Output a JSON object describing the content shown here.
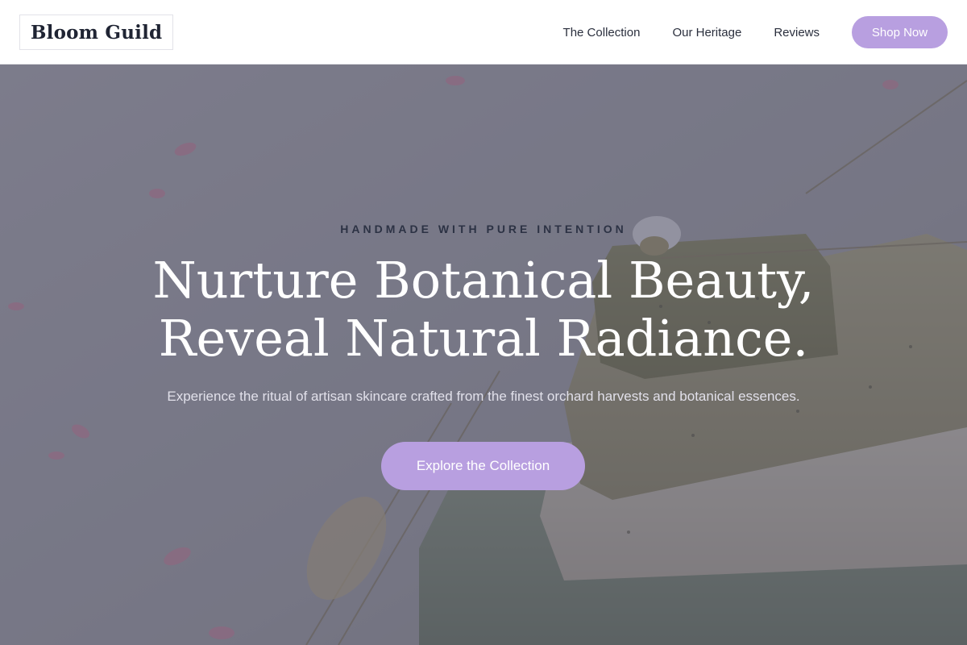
{
  "header": {
    "logo": "Bloom Guild",
    "nav": [
      {
        "label": "The Collection"
      },
      {
        "label": "Our Heritage"
      },
      {
        "label": "Reviews"
      }
    ],
    "cta_label": "Shop Now"
  },
  "hero": {
    "eyebrow": "HANDMADE WITH PURE INTENTION",
    "headline_line1": "Nurture Botanical Beauty,",
    "headline_line2": "Reveal Natural Radiance.",
    "subtext": "Experience the ritual of artisan skincare crafted from the finest orchard harvests and botanical essences.",
    "cta_label": "Explore the Collection",
    "background_image": "soap-bars-dried-flowers-photo"
  },
  "colors": {
    "accent": "#b89fe0",
    "text_dark": "#1f2433",
    "overlay": "#5c5f73"
  }
}
